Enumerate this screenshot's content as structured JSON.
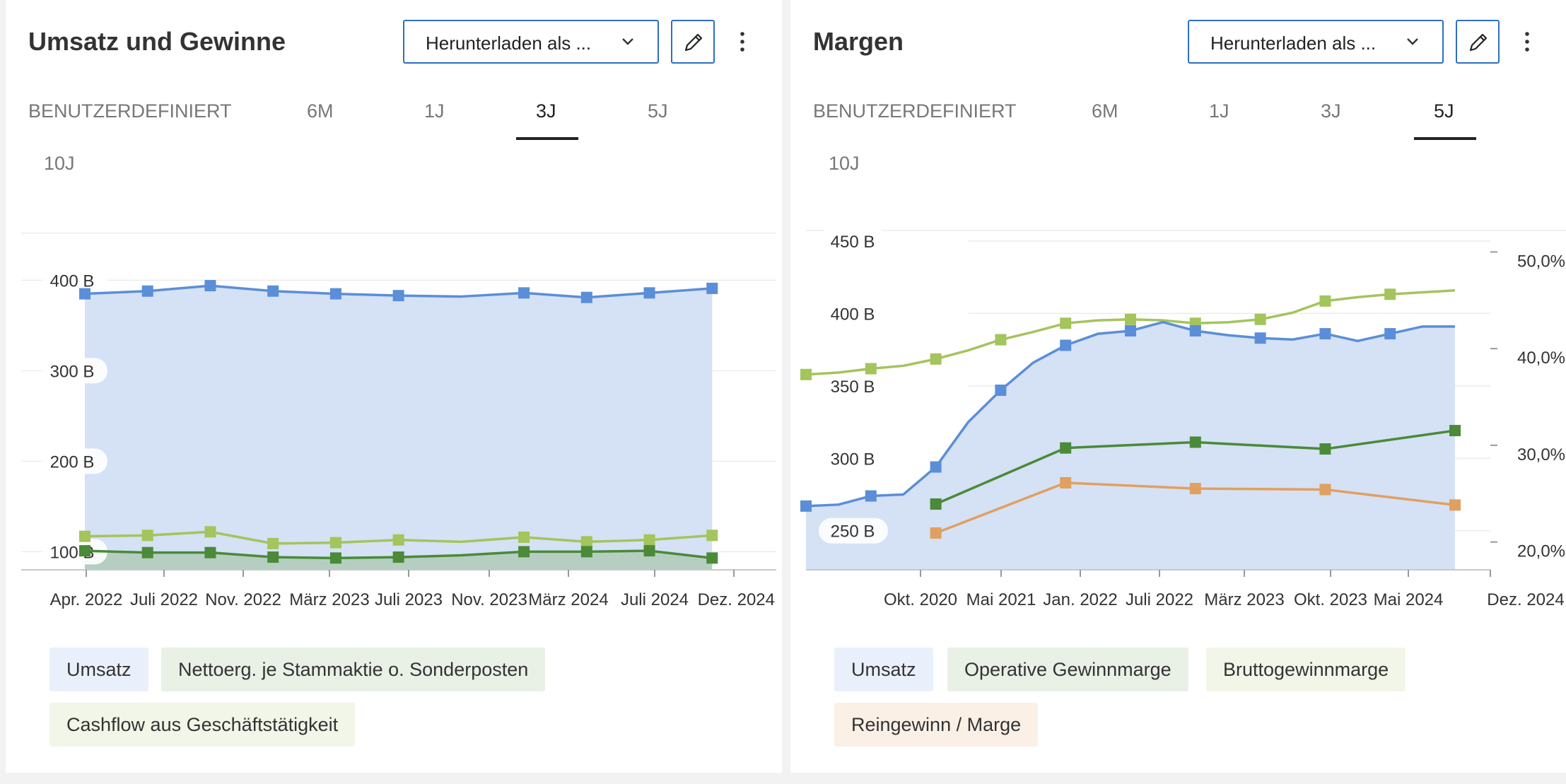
{
  "panels": [
    {
      "title": "Umsatz und Gewinne",
      "download_label": "Herunterladen als ...",
      "tabs": [
        "BENUTZERDEFINIERT",
        "6M",
        "1J",
        "3J",
        "5J",
        "10J"
      ],
      "active_tab": "3J",
      "legend": [
        "Umsatz",
        "Nettoerg. je Stammaktie o. Sonderposten",
        "Cashflow aus Geschäftstätigkeit"
      ]
    },
    {
      "title": "Margen",
      "download_label": "Herunterladen als ...",
      "tabs": [
        "BENUTZERDEFINIERT",
        "6M",
        "1J",
        "3J",
        "5J",
        "10J"
      ],
      "active_tab": "5J",
      "legend": [
        "Umsatz",
        "Operative Gewinnmarge",
        "Bruttogewinnmarge",
        "Reingewinn / Marge"
      ]
    }
  ],
  "colors": {
    "accent": "#2f6fc2",
    "revenue": "#5b8ed8",
    "revenue_fill": "#d5e1f5",
    "dark_green": "#4a8a38",
    "light_green": "#a4c45c",
    "orange": "#e0a060"
  },
  "icons": {
    "dropdown": "chevron-down-icon",
    "edit": "pencil-icon",
    "menu": "more-vertical-icon"
  },
  "chart_data": [
    {
      "type": "area",
      "title": "Umsatz und Gewinne",
      "x_ticks": [
        "Apr. 2022",
        "Juli 2022",
        "Nov. 2022",
        "März 2023",
        "Juli 2023",
        "Nov. 2023",
        "März 2024",
        "Juli 2024",
        "Dez. 2024"
      ],
      "y_ticks": [
        "100 B",
        "200 B",
        "300 B",
        "400 B"
      ],
      "ylim": [
        80,
        455
      ],
      "series": [
        {
          "name": "Umsatz",
          "style": "area",
          "x": [
            2022.25,
            2022.5,
            2022.75,
            2023.0,
            2023.25,
            2023.5,
            2023.75,
            2024.0,
            2024.25,
            2024.5,
            2024.75
          ],
          "y": [
            385,
            388,
            394,
            388,
            385,
            383,
            382,
            386,
            381,
            386,
            391
          ],
          "markers": [
            true,
            true,
            true,
            true,
            true,
            true,
            false,
            true,
            true,
            true,
            true
          ]
        },
        {
          "name": "Nettoerg. je Stammaktie o. Sonderposten",
          "style": "area",
          "x": [
            2022.25,
            2022.5,
            2022.75,
            2023.0,
            2023.25,
            2023.5,
            2023.75,
            2024.0,
            2024.25,
            2024.5,
            2024.75
          ],
          "y": [
            101,
            99,
            99,
            94,
            93,
            94,
            96,
            100,
            100,
            101,
            93
          ],
          "markers": [
            true,
            true,
            true,
            true,
            true,
            true,
            false,
            true,
            true,
            true,
            true
          ]
        },
        {
          "name": "Cashflow aus Geschäftstätigkeit",
          "style": "line",
          "x": [
            2022.25,
            2022.5,
            2022.75,
            2023.0,
            2023.25,
            2023.5,
            2023.75,
            2024.0,
            2024.25,
            2024.5,
            2024.75
          ],
          "y": [
            117,
            118,
            122,
            109,
            110,
            113,
            111,
            116,
            111,
            113,
            118
          ],
          "markers": [
            true,
            true,
            true,
            true,
            true,
            true,
            false,
            true,
            true,
            true,
            true
          ]
        }
      ],
      "grid": true
    },
    {
      "type": "area",
      "title": "Margen",
      "x_ticks": [
        "Okt. 2020",
        "Mai 2021",
        "Jan. 2022",
        "Juli 2022",
        "März 2023",
        "Okt. 2023",
        "Mai 2024",
        "Dez. 2024"
      ],
      "y_left_ticks": [
        "250 B",
        "300 B",
        "350 B",
        "400 B",
        "450 B"
      ],
      "y_right_ticks": [
        "20,0%",
        "30,0%",
        "40,0%",
        "50,0%"
      ],
      "ylim_left": [
        223,
        470
      ],
      "ylim_right": [
        18.0,
        55.0
      ],
      "series": [
        {
          "name": "Umsatz",
          "axis": "left",
          "style": "area",
          "x": [
            2019.75,
            2020.0,
            2020.25,
            2020.5,
            2020.75,
            2021.0,
            2021.25,
            2021.5,
            2021.75,
            2022.0,
            2022.25,
            2022.5,
            2022.75,
            2023.0,
            2023.25,
            2023.5,
            2023.75,
            2024.0,
            2024.25,
            2024.5,
            2024.75
          ],
          "y": [
            267,
            268,
            274,
            275,
            294,
            325,
            347,
            366,
            378,
            386,
            388,
            394,
            388,
            385,
            383,
            382,
            386,
            381,
            386,
            391,
            391
          ],
          "markers": [
            true,
            false,
            true,
            false,
            true,
            false,
            true,
            false,
            true,
            false,
            true,
            false,
            true,
            false,
            true,
            false,
            true,
            false,
            true,
            false,
            false
          ]
        },
        {
          "name": "Bruttogewinnmarge",
          "axis": "right",
          "style": "line",
          "x": [
            2019.75,
            2020.0,
            2020.25,
            2020.5,
            2020.75,
            2021.0,
            2021.25,
            2021.5,
            2021.75,
            2022.0,
            2022.25,
            2022.5,
            2022.75,
            2023.0,
            2023.25,
            2023.5,
            2023.75,
            2024.0,
            2024.25,
            2024.5,
            2024.75
          ],
          "y": [
            38.2,
            38.4,
            38.8,
            39.1,
            39.8,
            40.7,
            41.8,
            42.6,
            43.5,
            43.8,
            43.9,
            43.8,
            43.5,
            43.6,
            43.9,
            44.6,
            45.8,
            46.2,
            46.5,
            46.7,
            46.9
          ],
          "markers": [
            true,
            false,
            true,
            false,
            true,
            false,
            true,
            false,
            true,
            false,
            true,
            false,
            true,
            false,
            true,
            false,
            true,
            false,
            true,
            false,
            false
          ]
        },
        {
          "name": "Operative Gewinnmarge",
          "axis": "right",
          "style": "line",
          "x": [
            2020.75,
            2021.75,
            2022.75,
            2023.75,
            2024.75
          ],
          "y": [
            24.8,
            30.6,
            31.2,
            30.5,
            32.4
          ],
          "markers": [
            true,
            true,
            true,
            true,
            true
          ]
        },
        {
          "name": "Reingewinn / Marge",
          "axis": "right",
          "style": "line",
          "x": [
            2020.75,
            2021.75,
            2022.75,
            2023.75,
            2024.75
          ],
          "y": [
            21.8,
            27.0,
            26.4,
            26.3,
            24.7
          ],
          "markers": [
            true,
            true,
            true,
            true,
            true
          ]
        }
      ],
      "grid": true
    }
  ]
}
